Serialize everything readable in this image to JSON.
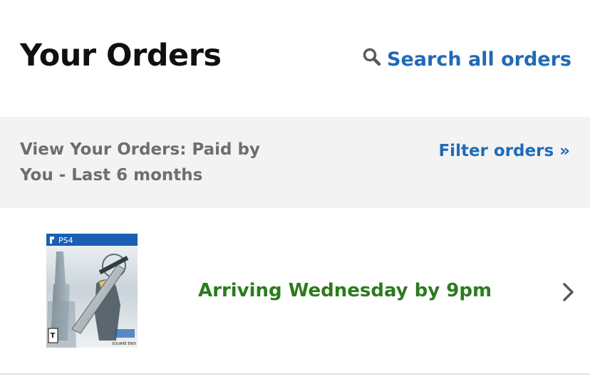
{
  "header": {
    "title": "Your Orders",
    "search_label": "Search all orders"
  },
  "filter_bar": {
    "description": "View Your Orders: Paid by You - Last 6 months",
    "filter_label": "Filter orders »"
  },
  "orders": [
    {
      "status": "Arriving Wednesday by 9pm",
      "thumbnail": {
        "platform_label": "PS4",
        "rating_badge": "T",
        "publisher": "SQUARE ENIX"
      }
    }
  ],
  "colors": {
    "link": "#1f6ab8",
    "status_green": "#2c7b1e",
    "filter_bar_bg": "#f3f3f3",
    "title": "#0f1111",
    "muted_text": "#6b6f70"
  },
  "icons": {
    "search": "search-icon",
    "chevron": "chevron-right-icon"
  }
}
